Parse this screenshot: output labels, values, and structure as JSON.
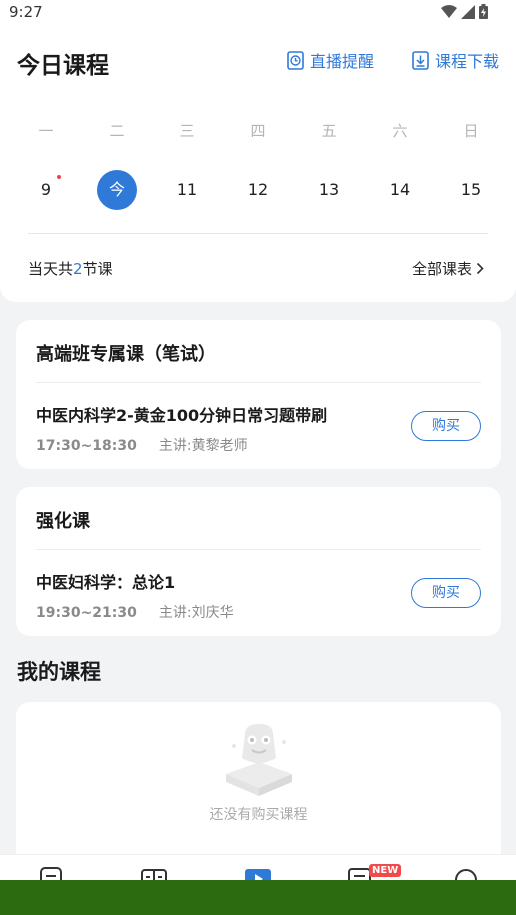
{
  "status": {
    "time": "9:27"
  },
  "header": {
    "title": "今日课程",
    "remind_label": "直播提醒",
    "download_label": "课程下载"
  },
  "calendar": {
    "weekdays": [
      "一",
      "二",
      "三",
      "四",
      "五",
      "六",
      "日"
    ],
    "dates": [
      "9",
      "今",
      "11",
      "12",
      "13",
      "14",
      "15"
    ],
    "today_index": 1,
    "dot_index": 0
  },
  "summary": {
    "prefix": "当天共",
    "count": "2",
    "suffix": "节课",
    "all_label": "全部课表"
  },
  "courses": [
    {
      "title": "高端班专属课（笔试）",
      "lesson": "中医内科学2-黄金100分钟日常习题带刷",
      "time": "17:30~18:30",
      "teacher": "主讲:黄黎老师",
      "button": "购买"
    },
    {
      "title": "强化课",
      "lesson": "中医妇科学：总论1",
      "time": "19:30~21:30",
      "teacher": "主讲:刘庆华",
      "button": "购买"
    }
  ],
  "my_courses": {
    "title": "我的课程",
    "empty_text": "还没有购买课程"
  },
  "nav": {
    "badge": "NEW"
  },
  "colors": {
    "accent": "#2f7ad8",
    "dot": "#f04444",
    "badge": "#f04a4a"
  }
}
